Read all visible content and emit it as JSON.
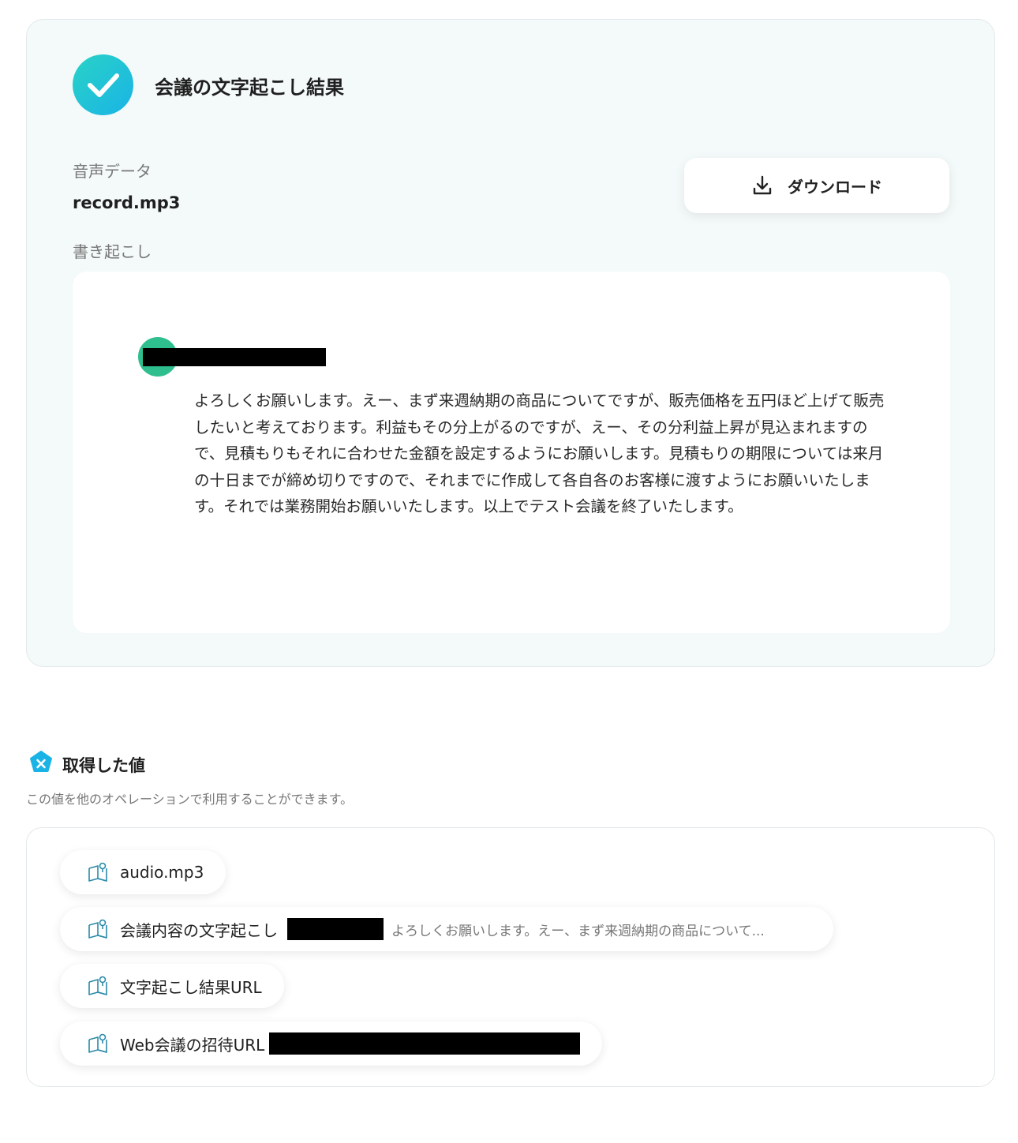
{
  "result": {
    "title": "会議の文字起こし結果",
    "audio_label": "音声データ",
    "audio_filename": "record.mp3",
    "download_label": "ダウンロード",
    "transcript_label": "書き起こし",
    "transcript_text": "よろしくお願いします。えー、まず来週納期の商品についてですが、販売価格を五円ほど上げて販売したいと考えております。利益もその分上がるのですが、えー、その分利益上昇が見込まれますので、見積もりもそれに合わせた金額を設定するようにお願いします。見積もりの期限については来月の十日までが締め切りですので、それまでに作成して各自各のお客様に渡すようにお願いいたします。それでは業務開始お願いいたします。以上でテスト会議を終了いたします。"
  },
  "values_section": {
    "title": "取得した値",
    "description": "この値を他のオペレーションで利用することができます。",
    "items": [
      {
        "label": "audio.mp3",
        "preview": ""
      },
      {
        "label": "会議内容の文字起こし",
        "preview": "よろしくお願いします。えー、まず来週納期の商品について..."
      },
      {
        "label": "文字起こし結果URL",
        "preview": ""
      },
      {
        "label": "Web会議の招待URL",
        "preview": ""
      }
    ]
  },
  "colors": {
    "accent": "#1ab3e6",
    "check_gradient_start": "#29d3c6",
    "speaker": "#2fbf8f"
  },
  "icons": {
    "status": "check-icon",
    "download": "download-icon",
    "section": "variable-badge-icon",
    "item": "book-icon"
  }
}
